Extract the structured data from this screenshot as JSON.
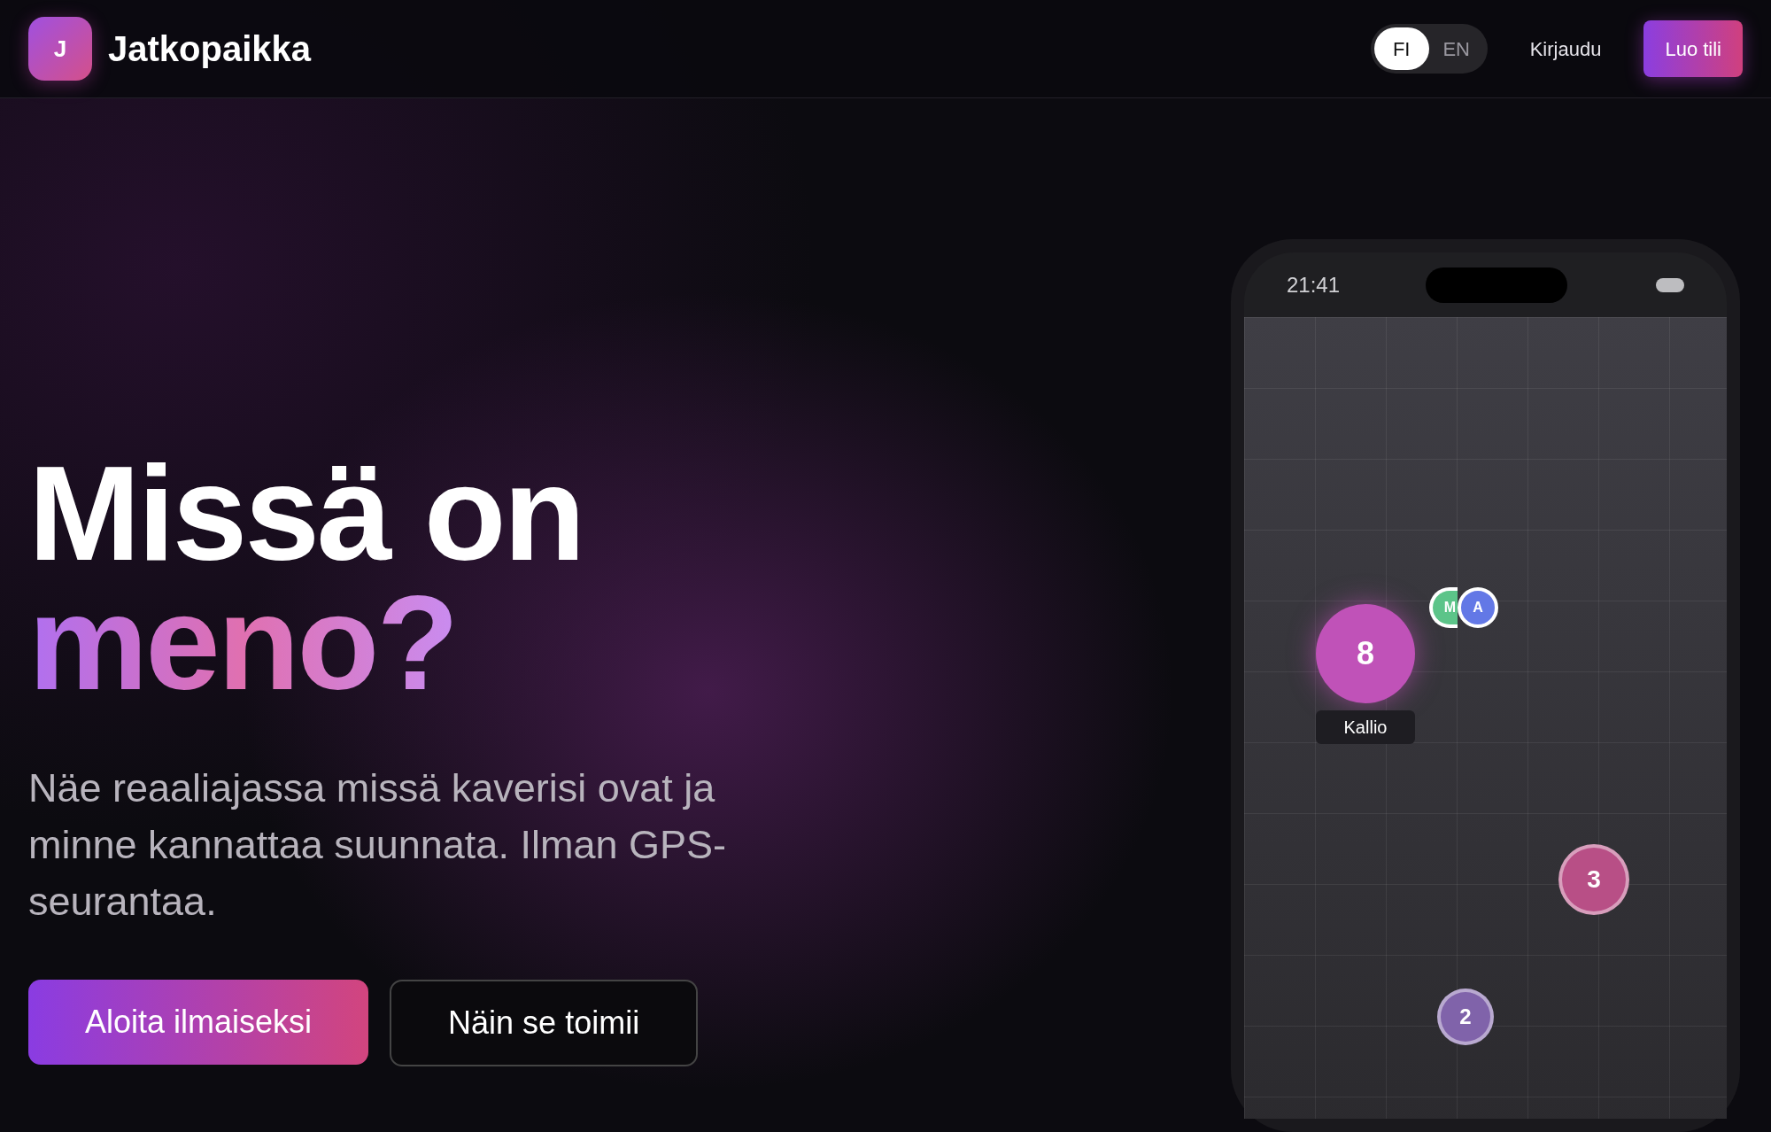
{
  "brand": {
    "logo_letter": "J",
    "name": "Jatkopaikka"
  },
  "languages": [
    {
      "label": "FI",
      "selected": true
    },
    {
      "label": "EN",
      "selected": false
    }
  ],
  "nav": {
    "login": "Kirjaudu",
    "signup": "Luo tili"
  },
  "hero": {
    "headline_line_1": "Missä on",
    "headline_line_2": "meno?",
    "subtitle": "Näe reaaliajassa missä kaverisi ovat ja minne kannattaa suunnata. Ilman GPS-seurantaa.",
    "primary_button": "Aloita ilmaiseksi",
    "secondary_button": "Näin se toimii"
  },
  "phone": {
    "time": "21:41",
    "hotspots": [
      {
        "count": "8",
        "label": "Kallio",
        "color": "#c052b8"
      },
      {
        "count": "3",
        "color": "#b84f86"
      },
      {
        "count": "2",
        "color": "#8063aa"
      }
    ],
    "friends": [
      {
        "initial": "M",
        "color": "#5cc489"
      },
      {
        "initial": "A",
        "color": "#6378e6"
      }
    ]
  }
}
